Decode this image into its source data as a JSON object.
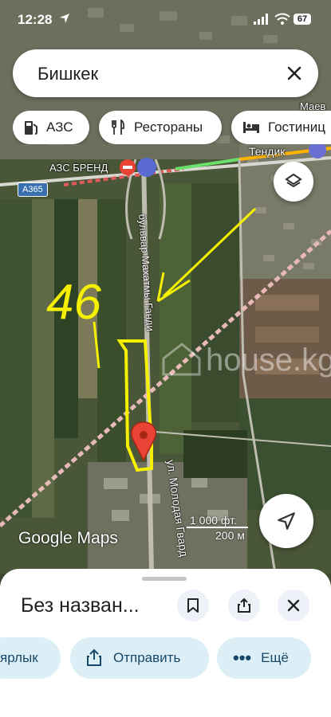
{
  "status_bar": {
    "time": "12:28",
    "battery": "67"
  },
  "search": {
    "query": "Бишкек"
  },
  "chips": [
    {
      "label": "АЗС",
      "icon": "gas-station-icon"
    },
    {
      "label": "Рестораны",
      "icon": "restaurant-icon"
    },
    {
      "label": "Гостиниц",
      "icon": "hotel-icon"
    }
  ],
  "map_labels": {
    "station": "АЗС БРЕНД",
    "route": "A365",
    "tendik": "Тендик",
    "corner": "Маев",
    "boulevard": "бульвар Махатмы Ганди",
    "street": "ул. Молодая Гвард",
    "watermark": "house.kg"
  },
  "annotation": {
    "number": "46"
  },
  "attribution": "Google Maps",
  "scale": {
    "imperial": "1 000 фт.",
    "metric": "200 м"
  },
  "place": {
    "title": "Без назван..."
  },
  "actions": [
    {
      "label": "ярлык",
      "icon": "label-icon"
    },
    {
      "label": "Отправить",
      "icon": "share-icon"
    },
    {
      "label": "Ещё",
      "icon": "more-icon"
    }
  ],
  "colors": {
    "accent": "#1a73e8",
    "pin": "#ea4335",
    "annotation": "#f5f000",
    "pill": "#dceff6"
  }
}
